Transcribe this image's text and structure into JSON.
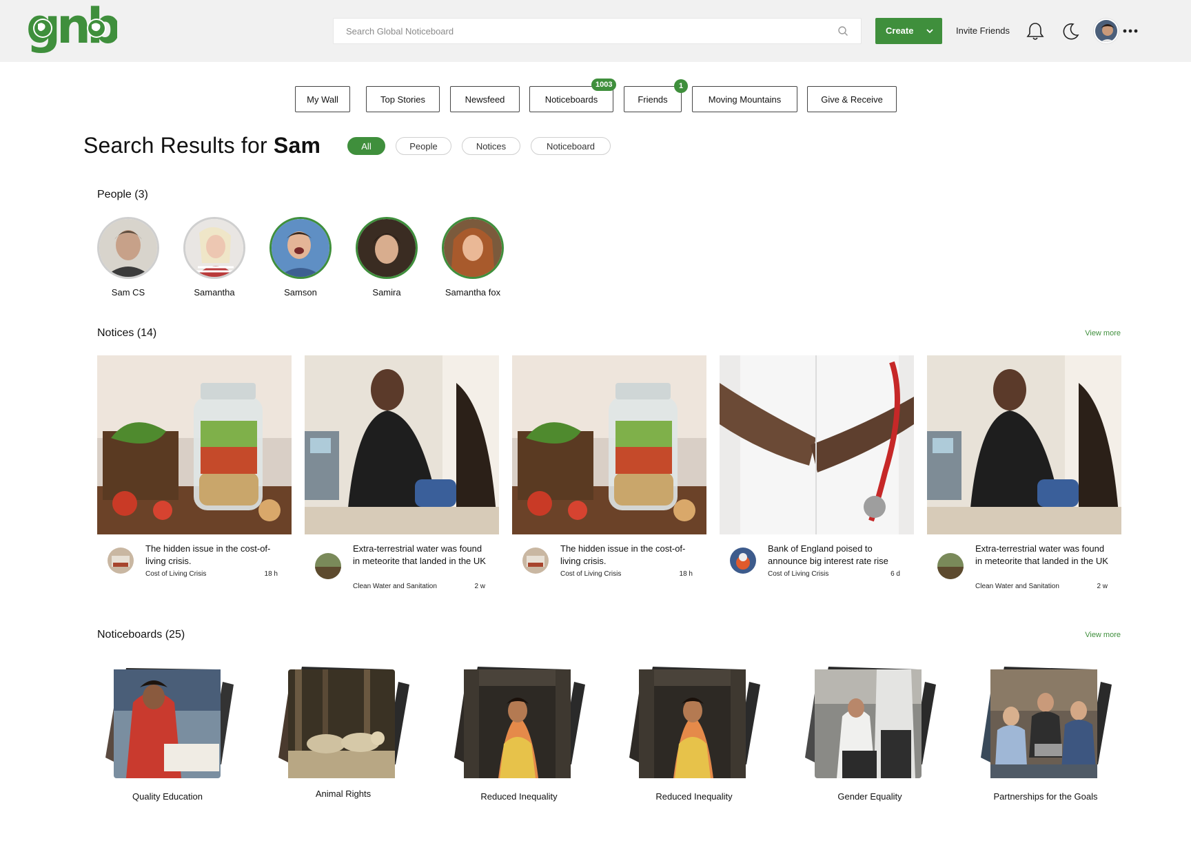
{
  "header": {
    "logo_text": "gnb",
    "search_placeholder": "Search Global Noticeboard",
    "create_label": "Create",
    "invite_label": "Invite Friends",
    "accent_color": "#3f8f3c"
  },
  "tabs": [
    {
      "label": "My Wall"
    },
    {
      "label": "Top Stories"
    },
    {
      "label": "Newsfeed"
    },
    {
      "label": "Noticeboards",
      "badge": "1003"
    },
    {
      "label": "Friends",
      "badge": "1"
    },
    {
      "label": "Moving Mountains"
    },
    {
      "label": "Give & Receive"
    }
  ],
  "results": {
    "title_prefix": "Search Results for",
    "query": "Sam",
    "filters": [
      "All",
      "People",
      "Notices",
      "Noticeboard"
    ],
    "active_filter": "All"
  },
  "people": {
    "heading": "People (3)",
    "items": [
      {
        "name": "Sam CS"
      },
      {
        "name": "Samantha"
      },
      {
        "name": "Samson"
      },
      {
        "name": "Samira"
      },
      {
        "name": "Samantha fox"
      }
    ]
  },
  "notices": {
    "heading": "Notices (14)",
    "view_more": "View more",
    "items": [
      {
        "title": "The hidden issue in the cost-of-living crisis.",
        "category": "Cost of Living Crisis",
        "age": "18 h",
        "image": "jar-salad-icon"
      },
      {
        "title": "Extra-terrestrial water was found in meteorite that landed in the UK",
        "category": "Clean Water and Sanitation",
        "age": "2 w",
        "image": "nurse-icon"
      },
      {
        "title": "The hidden issue in the cost-of-living crisis.",
        "category": "Cost of Living Crisis",
        "age": "18 h",
        "image": "jar-salad-icon"
      },
      {
        "title": "Bank of England poised to announce big interest rate rise",
        "category": "Cost of Living Crisis",
        "age": "6 d",
        "image": "doctor-icon"
      },
      {
        "title": "Extra-terrestrial water was found in meteorite that landed in the UK",
        "category": "Clean Water and Sanitation",
        "age": "2 w",
        "image": "nurse-icon"
      }
    ]
  },
  "noticeboards": {
    "heading": "Noticeboards (25)",
    "view_more": "View more",
    "items": [
      {
        "label": "Quality Education",
        "image": "classroom-icon"
      },
      {
        "label": "Animal Rights",
        "image": "wolves-icon"
      },
      {
        "label": "Reduced Inequality",
        "image": "dancer-icon"
      },
      {
        "label": "Reduced Inequality",
        "image": "dancer-icon"
      },
      {
        "label": "Gender Equality",
        "image": "people-street-icon"
      },
      {
        "label": "Partnerships for the Goals",
        "image": "friends-laptop-icon"
      }
    ]
  }
}
